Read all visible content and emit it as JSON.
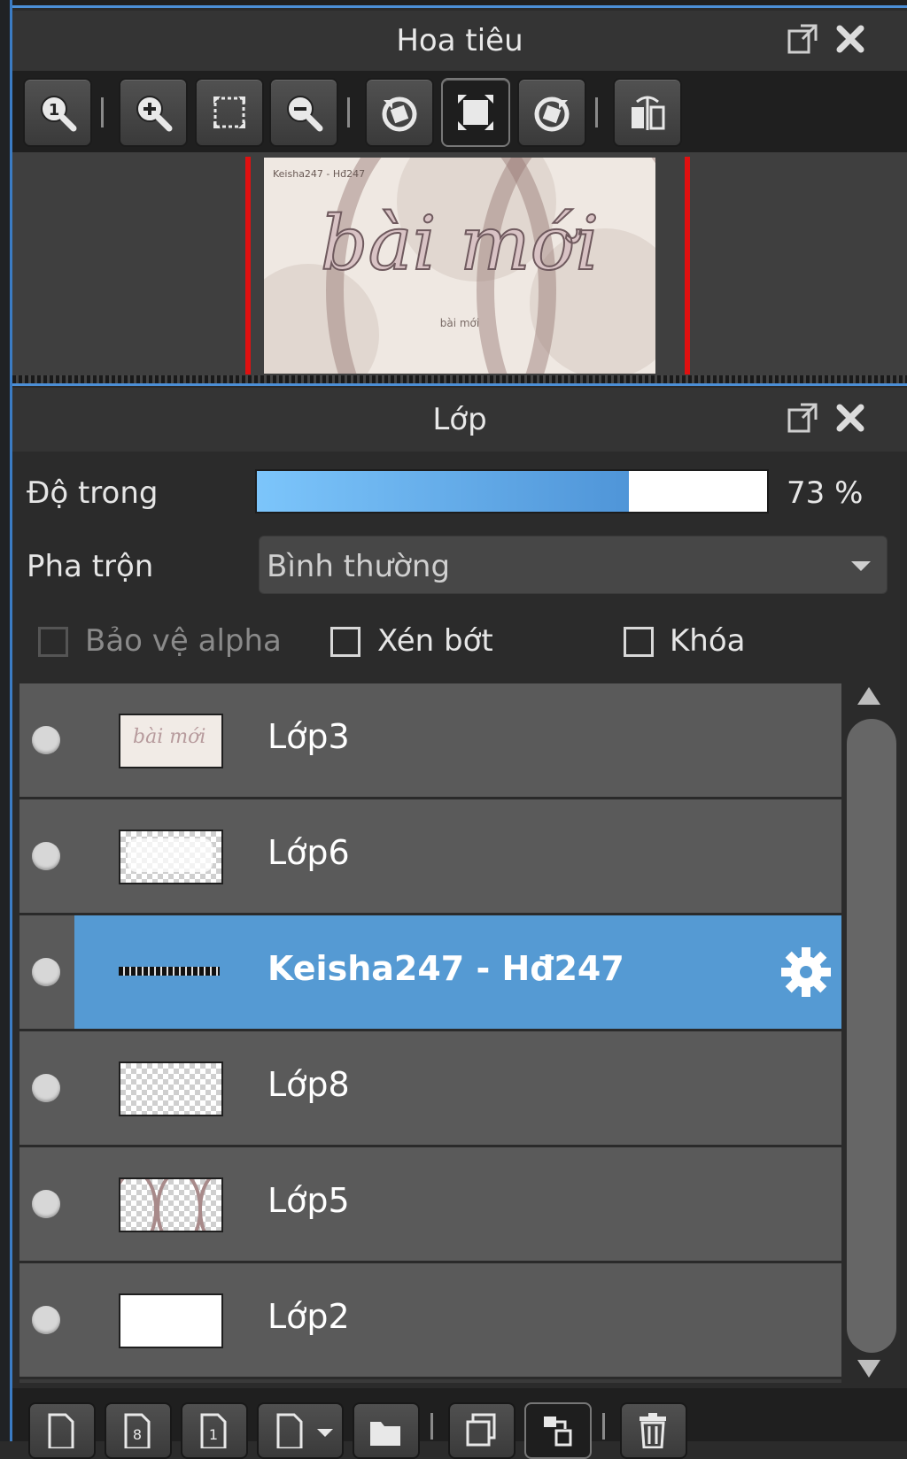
{
  "navigator": {
    "title": "Hoa tiêu",
    "preview": {
      "title_text": "bài mới",
      "small_text": "Keisha247 - Hđ247",
      "sub_text": "bài mới"
    },
    "toolbar": [
      {
        "name": "zoom-actual-button",
        "icon": "zoom-actual-icon"
      },
      {
        "name": "zoom-in-button",
        "icon": "zoom-in-icon"
      },
      {
        "name": "fit-screen-button",
        "icon": "fit-screen-icon"
      },
      {
        "name": "zoom-out-button",
        "icon": "zoom-out-icon"
      },
      {
        "name": "rotate-left-button",
        "icon": "rotate-left-icon"
      },
      {
        "name": "reset-rotation-button",
        "icon": "reset-rotation-icon"
      },
      {
        "name": "rotate-right-button",
        "icon": "rotate-right-icon"
      },
      {
        "name": "flip-horizontal-button",
        "icon": "flip-horizontal-icon"
      }
    ]
  },
  "layers_panel": {
    "title": "Lớp",
    "opacity_label": "Độ trong",
    "opacity_value": 73,
    "opacity_text": "73 %",
    "blend_label": "Pha trộn",
    "blend_value": "Bình thường",
    "checkboxes": {
      "protect_alpha": {
        "label": "Bảo vệ alpha",
        "checked": false,
        "enabled": false
      },
      "clipping": {
        "label": "Xén bớt",
        "checked": false,
        "enabled": true
      },
      "lock": {
        "label": "Khóa",
        "checked": false,
        "enabled": true
      }
    },
    "layers": [
      {
        "name": "Lớp3",
        "selected": false
      },
      {
        "name": "Lớp6",
        "selected": false
      },
      {
        "name": "Keisha247 - Hđ247",
        "selected": true
      },
      {
        "name": "Lớp8",
        "selected": false
      },
      {
        "name": "Lớp5",
        "selected": false
      },
      {
        "name": "Lớp2",
        "selected": false
      }
    ],
    "thumb_text": "bài mới"
  },
  "colors": {
    "accent": "#4c8fd6",
    "selected_row": "#559ad3",
    "preview_border": "#e01010"
  }
}
